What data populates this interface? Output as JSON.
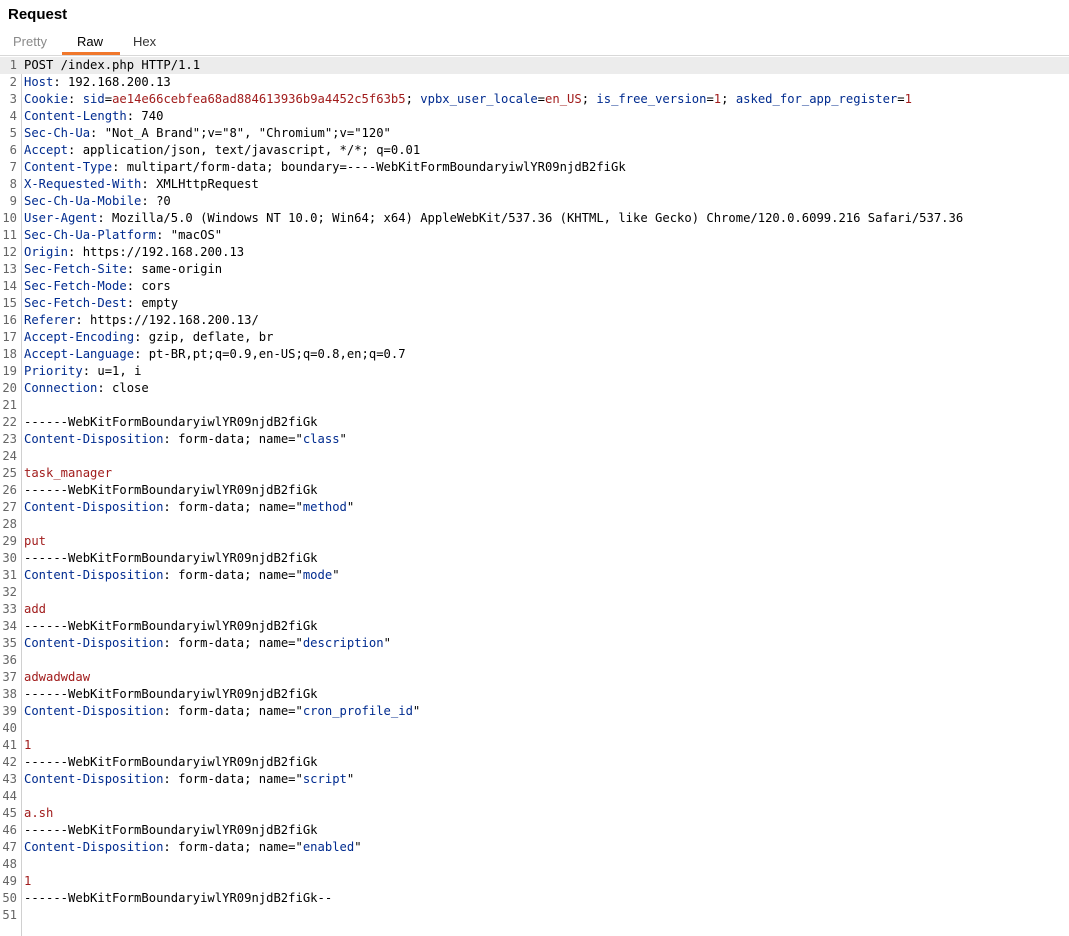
{
  "panel": {
    "title": "Request"
  },
  "tabs": [
    {
      "label": "Pretty"
    },
    {
      "label": "Raw"
    },
    {
      "label": "Hex"
    }
  ],
  "colors": {
    "accent": "#f0772b",
    "header_name": "#002b8f",
    "value": "#a11c1c"
  },
  "lines": [
    {
      "n": "1",
      "parts": [
        [
          "t",
          "POST /index.php HTTP/1.1"
        ]
      ]
    },
    {
      "n": "2",
      "parts": [
        [
          "h",
          "Host"
        ],
        [
          "t",
          ": 192.168.200.13"
        ]
      ]
    },
    {
      "n": "3",
      "parts": [
        [
          "h",
          "Cookie"
        ],
        [
          "t",
          ": "
        ],
        [
          "ck",
          "sid"
        ],
        [
          "t",
          "="
        ],
        [
          "cv",
          "ae14e66cebfea68ad884613936b9a4452c5f63b5"
        ],
        [
          "t",
          "; "
        ],
        [
          "ck",
          "vpbx_user_locale"
        ],
        [
          "t",
          "="
        ],
        [
          "cv",
          "en_US"
        ],
        [
          "t",
          "; "
        ],
        [
          "ck",
          "is_free_version"
        ],
        [
          "t",
          "="
        ],
        [
          "cv",
          "1"
        ],
        [
          "t",
          "; "
        ],
        [
          "ck",
          "asked_for_app_register"
        ],
        [
          "t",
          "="
        ],
        [
          "cv",
          "1"
        ]
      ]
    },
    {
      "n": "4",
      "parts": [
        [
          "h",
          "Content-Length"
        ],
        [
          "t",
          ": 740"
        ]
      ]
    },
    {
      "n": "5",
      "parts": [
        [
          "h",
          "Sec-Ch-Ua"
        ],
        [
          "t",
          ": \"Not_A Brand\";v=\"8\", \"Chromium\";v=\"120\""
        ]
      ]
    },
    {
      "n": "6",
      "parts": [
        [
          "h",
          "Accept"
        ],
        [
          "t",
          ": application/json, text/javascript, */*; q=0.01"
        ]
      ]
    },
    {
      "n": "7",
      "parts": [
        [
          "h",
          "Content-Type"
        ],
        [
          "t",
          ": multipart/form-data; boundary=----WebKitFormBoundaryiwlYR09njdB2fiGk"
        ]
      ]
    },
    {
      "n": "8",
      "parts": [
        [
          "h",
          "X-Requested-With"
        ],
        [
          "t",
          ": XMLHttpRequest"
        ]
      ]
    },
    {
      "n": "9",
      "parts": [
        [
          "h",
          "Sec-Ch-Ua-Mobile"
        ],
        [
          "t",
          ": ?0"
        ]
      ]
    },
    {
      "n": "10",
      "parts": [
        [
          "h",
          "User-Agent"
        ],
        [
          "t",
          ": Mozilla/5.0 (Windows NT 10.0; Win64; x64) AppleWebKit/537.36 (KHTML, like Gecko) Chrome/120.0.6099.216 Safari/537.36"
        ]
      ]
    },
    {
      "n": "11",
      "parts": [
        [
          "h",
          "Sec-Ch-Ua-Platform"
        ],
        [
          "t",
          ": \"macOS\""
        ]
      ]
    },
    {
      "n": "12",
      "parts": [
        [
          "h",
          "Origin"
        ],
        [
          "t",
          ": https://192.168.200.13"
        ]
      ]
    },
    {
      "n": "13",
      "parts": [
        [
          "h",
          "Sec-Fetch-Site"
        ],
        [
          "t",
          ": same-origin"
        ]
      ]
    },
    {
      "n": "14",
      "parts": [
        [
          "h",
          "Sec-Fetch-Mode"
        ],
        [
          "t",
          ": cors"
        ]
      ]
    },
    {
      "n": "15",
      "parts": [
        [
          "h",
          "Sec-Fetch-Dest"
        ],
        [
          "t",
          ": empty"
        ]
      ]
    },
    {
      "n": "16",
      "parts": [
        [
          "h",
          "Referer"
        ],
        [
          "t",
          ": https://192.168.200.13/"
        ]
      ]
    },
    {
      "n": "17",
      "parts": [
        [
          "h",
          "Accept-Encoding"
        ],
        [
          "t",
          ": gzip, deflate, br"
        ]
      ]
    },
    {
      "n": "18",
      "parts": [
        [
          "h",
          "Accept-Language"
        ],
        [
          "t",
          ": pt-BR,pt;q=0.9,en-US;q=0.8,en;q=0.7"
        ]
      ]
    },
    {
      "n": "19",
      "parts": [
        [
          "h",
          "Priority"
        ],
        [
          "t",
          ": u=1, i"
        ]
      ]
    },
    {
      "n": "20",
      "parts": [
        [
          "h",
          "Connection"
        ],
        [
          "t",
          ": close"
        ]
      ]
    },
    {
      "n": "21",
      "parts": []
    },
    {
      "n": "22",
      "parts": [
        [
          "t",
          "------WebKitFormBoundaryiwlYR09njdB2fiGk"
        ]
      ]
    },
    {
      "n": "23",
      "parts": [
        [
          "h",
          "Content-Disposition"
        ],
        [
          "t",
          ": form-data; name=\""
        ],
        [
          "q",
          "class"
        ],
        [
          "t",
          "\""
        ]
      ]
    },
    {
      "n": "24",
      "parts": []
    },
    {
      "n": "25",
      "parts": [
        [
          "b",
          "task_manager"
        ]
      ]
    },
    {
      "n": "26",
      "parts": [
        [
          "t",
          "------WebKitFormBoundaryiwlYR09njdB2fiGk"
        ]
      ]
    },
    {
      "n": "27",
      "parts": [
        [
          "h",
          "Content-Disposition"
        ],
        [
          "t",
          ": form-data; name=\""
        ],
        [
          "q",
          "method"
        ],
        [
          "t",
          "\""
        ]
      ]
    },
    {
      "n": "28",
      "parts": []
    },
    {
      "n": "29",
      "parts": [
        [
          "b",
          "put"
        ]
      ]
    },
    {
      "n": "30",
      "parts": [
        [
          "t",
          "------WebKitFormBoundaryiwlYR09njdB2fiGk"
        ]
      ]
    },
    {
      "n": "31",
      "parts": [
        [
          "h",
          "Content-Disposition"
        ],
        [
          "t",
          ": form-data; name=\""
        ],
        [
          "q",
          "mode"
        ],
        [
          "t",
          "\""
        ]
      ]
    },
    {
      "n": "32",
      "parts": []
    },
    {
      "n": "33",
      "parts": [
        [
          "b",
          "add"
        ]
      ]
    },
    {
      "n": "34",
      "parts": [
        [
          "t",
          "------WebKitFormBoundaryiwlYR09njdB2fiGk"
        ]
      ]
    },
    {
      "n": "35",
      "parts": [
        [
          "h",
          "Content-Disposition"
        ],
        [
          "t",
          ": form-data; name=\""
        ],
        [
          "q",
          "description"
        ],
        [
          "t",
          "\""
        ]
      ]
    },
    {
      "n": "36",
      "parts": []
    },
    {
      "n": "37",
      "parts": [
        [
          "b",
          "adwadwdaw"
        ]
      ]
    },
    {
      "n": "38",
      "parts": [
        [
          "t",
          "------WebKitFormBoundaryiwlYR09njdB2fiGk"
        ]
      ]
    },
    {
      "n": "39",
      "parts": [
        [
          "h",
          "Content-Disposition"
        ],
        [
          "t",
          ": form-data; name=\""
        ],
        [
          "q",
          "cron_profile_id"
        ],
        [
          "t",
          "\""
        ]
      ]
    },
    {
      "n": "40",
      "parts": []
    },
    {
      "n": "41",
      "parts": [
        [
          "b",
          "1"
        ]
      ]
    },
    {
      "n": "42",
      "parts": [
        [
          "t",
          "------WebKitFormBoundaryiwlYR09njdB2fiGk"
        ]
      ]
    },
    {
      "n": "43",
      "parts": [
        [
          "h",
          "Content-Disposition"
        ],
        [
          "t",
          ": form-data; name=\""
        ],
        [
          "q",
          "script"
        ],
        [
          "t",
          "\""
        ]
      ]
    },
    {
      "n": "44",
      "parts": []
    },
    {
      "n": "45",
      "parts": [
        [
          "b",
          "a.sh"
        ]
      ]
    },
    {
      "n": "46",
      "parts": [
        [
          "t",
          "------WebKitFormBoundaryiwlYR09njdB2fiGk"
        ]
      ]
    },
    {
      "n": "47",
      "parts": [
        [
          "h",
          "Content-Disposition"
        ],
        [
          "t",
          ": form-data; name=\""
        ],
        [
          "q",
          "enabled"
        ],
        [
          "t",
          "\""
        ]
      ]
    },
    {
      "n": "48",
      "parts": []
    },
    {
      "n": "49",
      "parts": [
        [
          "b",
          "1"
        ]
      ]
    },
    {
      "n": "50",
      "parts": [
        [
          "t",
          "------WebKitFormBoundaryiwlYR09njdB2fiGk--"
        ]
      ]
    },
    {
      "n": "51",
      "parts": []
    }
  ]
}
